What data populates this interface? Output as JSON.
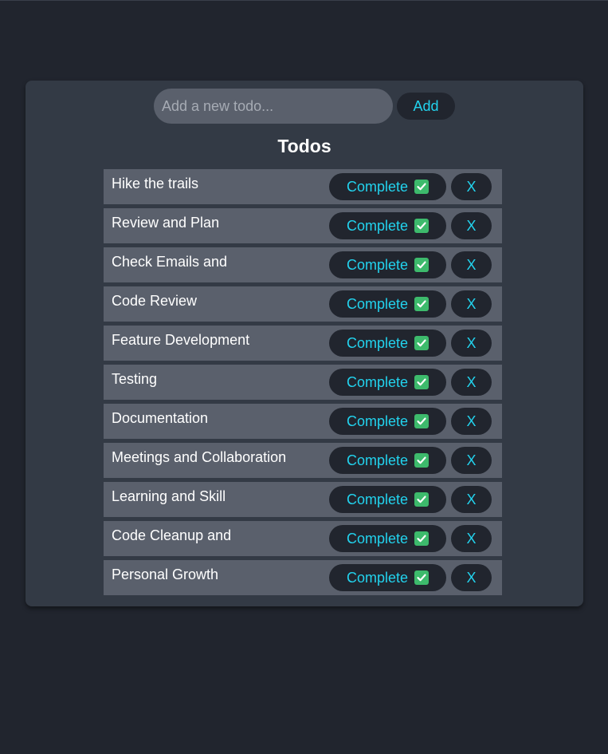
{
  "new_todo": {
    "placeholder": "Add a new todo...",
    "value": "",
    "add_label": "Add"
  },
  "title": "Todos",
  "complete_label": "Complete",
  "delete_label": "X",
  "colors": {
    "background": "#21252e",
    "card": "#333a45",
    "item": "#5a606c",
    "accent": "#22d3ee",
    "check": "#3dba6c"
  },
  "todos": [
    {
      "text": "Hike the trails"
    },
    {
      "text": "Review and Plan"
    },
    {
      "text": "Check Emails and"
    },
    {
      "text": "Code Review"
    },
    {
      "text": "Feature Development"
    },
    {
      "text": "Testing"
    },
    {
      "text": "Documentation"
    },
    {
      "text": "Meetings and Collaboration"
    },
    {
      "text": "Learning and Skill"
    },
    {
      "text": "Code Cleanup and"
    },
    {
      "text": "Personal Growth"
    }
  ]
}
